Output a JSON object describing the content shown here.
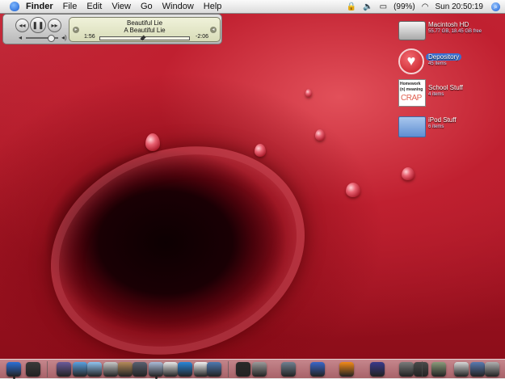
{
  "menubar": {
    "menus": [
      "Finder",
      "File",
      "Edit",
      "View",
      "Go",
      "Window",
      "Help"
    ],
    "battery": "(99%)",
    "clock": "Sun 20:50:19"
  },
  "itunes": {
    "song": "Beautiful Lie",
    "artist": "A Beautiful Lie",
    "elapsed": "1:56",
    "remaining": "-2:06",
    "progress_fraction": 0.48,
    "volume_fraction": 0.8
  },
  "desktop_icons": [
    {
      "name": "Macintosh HD",
      "info": "55.77 GB, 18.45 GB free",
      "icon": "hard-drive-icon"
    },
    {
      "name": "Depository",
      "info": "45 items",
      "icon": "heart-folder-icon",
      "selected": true
    },
    {
      "name": "School Stuff",
      "info": "4 items",
      "icon": "homework-folder-icon",
      "preview_lines": [
        "Homework",
        "(n) meaning",
        "CRAP"
      ]
    },
    {
      "name": "iPod Stuff",
      "info": "6 items",
      "icon": "folder-icon"
    }
  ],
  "dock": {
    "items": [
      "finder-icon",
      "dashboard-icon",
      "preview-icon",
      "safari-icon",
      "ichat-icon",
      "ichat-av-icon",
      "address-book-icon",
      "iphoto-icon",
      "itunes-icon",
      "ical-icon",
      "quicktime-icon",
      "textedit-icon",
      "photoshop-icon",
      "terminal-icon",
      "system-prefs-icon",
      "utilities-icon",
      "bluetooth-icon",
      "vlc-icon",
      "pen-icon",
      "disk-utility-icon",
      "activity-monitor-icon",
      "downloads-icon",
      "mail-icon",
      "applications-icon",
      "trash-icon"
    ],
    "colors": [
      "#2c6fd6",
      "#3a3a3a",
      "#6a5a9a",
      "#5aa0e0",
      "#8fc4f0",
      "#c9c9c9",
      "#b48a58",
      "#5a6070",
      "#aabbd8",
      "#e8e8e8",
      "#2a86d8",
      "#f2f2f2",
      "#4d79b0",
      "#2a2a2a",
      "#9a9a9a",
      "#708090",
      "#3a66c8",
      "#f28a18",
      "#3a3a8a",
      "#7a7a7a",
      "#4a4a4a",
      "#8a9a7a",
      "#d8d8d8",
      "#5a7ab0",
      "#b0b0b0"
    ]
  }
}
